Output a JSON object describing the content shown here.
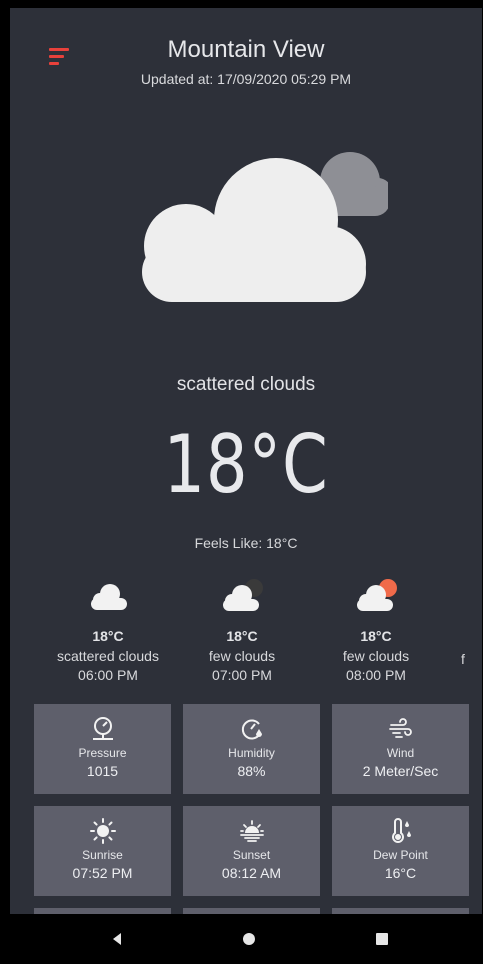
{
  "header": {
    "city": "Mountain View",
    "updated": "Updated at: 17/09/2020 05:29 PM"
  },
  "current": {
    "icon": "cloud-icon",
    "description": "scattered clouds",
    "temperature": "18°C",
    "feels_like": "Feels Like: 18°C"
  },
  "forecast": [
    {
      "icon": "cloud-icon",
      "temp": "18°C",
      "desc": "scattered clouds",
      "time": "06:00 PM"
    },
    {
      "icon": "cloud-moon-icon",
      "temp": "18°C",
      "desc": "few clouds",
      "time": "07:00 PM"
    },
    {
      "icon": "cloud-sun-icon",
      "temp": "18°C",
      "desc": "few clouds",
      "time": "08:00 PM"
    }
  ],
  "forecast_partial": "f",
  "details": [
    {
      "icon": "pressure-gauge-icon",
      "label": "Pressure",
      "value": "1015"
    },
    {
      "icon": "humidity-icon",
      "label": "Humidity",
      "value": "88%"
    },
    {
      "icon": "wind-icon",
      "label": "Wind",
      "value": "2 Meter/Sec"
    },
    {
      "icon": "sunrise-icon",
      "label": "Sunrise",
      "value": "07:52 PM"
    },
    {
      "icon": "sunset-icon",
      "label": "Sunset",
      "value": "08:12 AM"
    },
    {
      "icon": "dew-point-icon",
      "label": "Dew Point",
      "value": "16°C"
    }
  ],
  "colors": {
    "background": "#2d3039",
    "tile": "#5e5f6b",
    "accent_menu": "#e8413b",
    "sun": "#f06a4a"
  },
  "navigation": [
    "back-icon",
    "home-icon",
    "recents-icon"
  ]
}
